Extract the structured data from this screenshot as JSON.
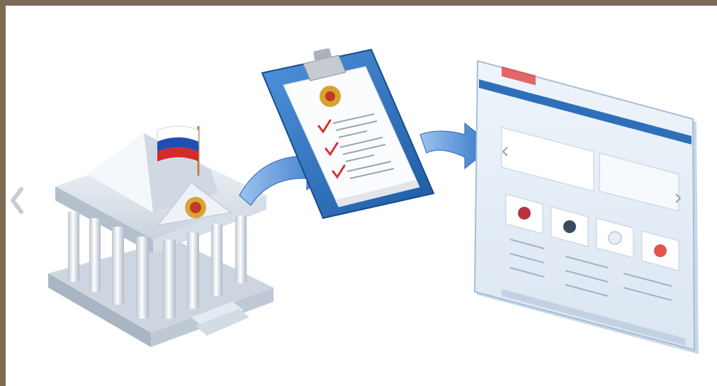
{
  "carousel": {
    "prev_icon": "chevron-left-icon"
  },
  "colors": {
    "frame": "#7d6a55",
    "stage": "#ffffff",
    "arrow_blue": "#3b7ed0",
    "clipboard_blue": "#2c6fb8",
    "building": "#dfe6ee",
    "flag_white": "#ffffff",
    "flag_blue": "#1f4fb5",
    "flag_red": "#d42a2a",
    "check_red": "#d93030"
  },
  "illustration": {
    "items": [
      "government-building-icon",
      "clipboard-document-icon",
      "website-screen-icon"
    ]
  }
}
